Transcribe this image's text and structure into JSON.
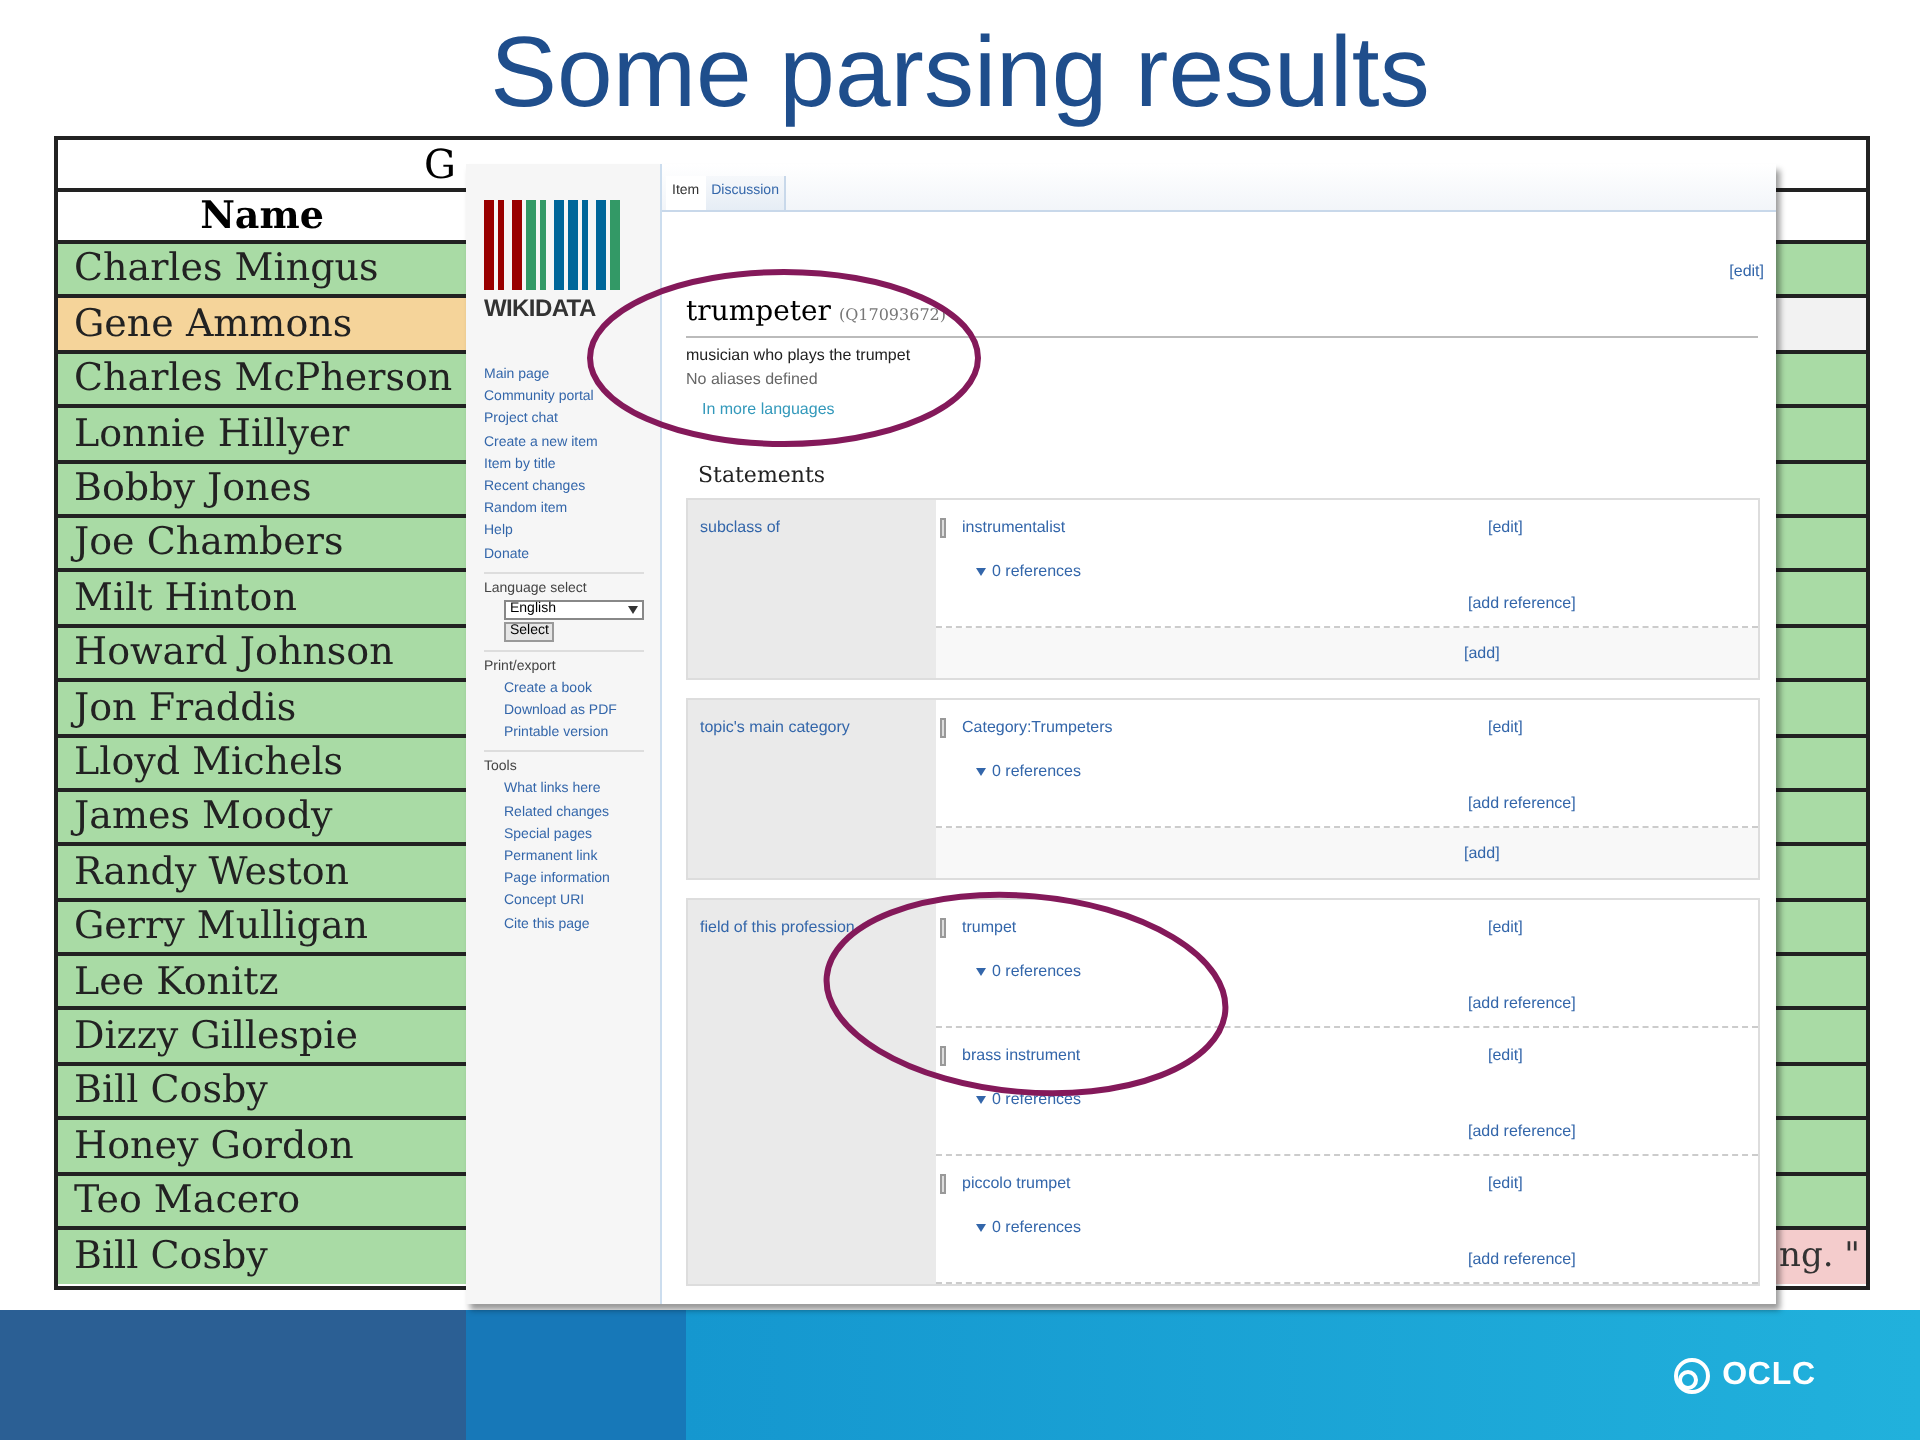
{
  "slide": {
    "title": "Some parsing results"
  },
  "table": {
    "header_top": "G",
    "name_header": "Name",
    "rows": [
      {
        "name": "Charles Mingus",
        "color": "#a9dba5",
        "extracted": {
          "color": "#a9dba5"
        }
      },
      {
        "name": "Gene Ammons",
        "color": "#f5d49a",
        "extracted": {
          "color": "#f2f2f2"
        }
      },
      {
        "name": "Charles McPherson",
        "color": "#a9dba5",
        "extracted": {
          "color": "#a9dba5"
        }
      },
      {
        "name": "Lonnie Hillyer",
        "color": "#a9dba5",
        "extracted": {
          "color": "#a9dba5"
        }
      },
      {
        "name": "Bobby Jones",
        "color": "#a9dba5",
        "extracted": {
          "color": "#a9dba5"
        }
      },
      {
        "name": "Joe Chambers",
        "color": "#a9dba5",
        "extracted": {
          "color": "#a9dba5"
        }
      },
      {
        "name": "Milt Hinton",
        "color": "#a9dba5",
        "extracted": {
          "color": "#a9dba5"
        }
      },
      {
        "name": "Howard Johnson",
        "color": "#a9dba5",
        "extracted": {
          "color": "#a9dba5"
        }
      },
      {
        "name": "Jon Fraddis",
        "color": "#a9dba5",
        "extracted": {
          "color": "#a9dba5"
        }
      },
      {
        "name": "Lloyd Michels",
        "color": "#a9dba5",
        "extracted": {
          "color": "#a9dba5"
        }
      },
      {
        "name": "James Moody",
        "color": "#a9dba5",
        "extracted": {
          "color": "#a9dba5"
        }
      },
      {
        "name": "Randy Weston",
        "color": "#a9dba5",
        "extracted": {
          "color": "#a9dba5"
        }
      },
      {
        "name": "Gerry Mulligan",
        "color": "#a9dba5",
        "extracted": {
          "color": "#a9dba5"
        }
      },
      {
        "name": "Lee Konitz",
        "color": "#a9dba5",
        "extracted": {
          "color": "#a9dba5"
        }
      },
      {
        "name": "Dizzy Gillespie",
        "color": "#a9dba5",
        "extracted": {
          "color": "#a9dba5"
        }
      },
      {
        "name": "Bill Cosby",
        "color": "#a9dba5",
        "extracted": {
          "color": "#a9dba5"
        }
      },
      {
        "name": "Honey Gordon",
        "color": "#a9dba5",
        "extracted": {
          "color": "#a9dba5"
        }
      },
      {
        "name": "Teo Macero",
        "color": "#a9dba5",
        "extracted": {
          "color": "#a9dba5"
        }
      },
      {
        "name": "Bill Cosby",
        "color": "#a9dba5",
        "extracted": {
          "color": "#f4cccc",
          "text": "ng. \""
        }
      }
    ]
  },
  "wikidata": {
    "logo_text": "WIKIDATA",
    "nav": [
      "Main page",
      "Community portal",
      "Project chat",
      "Create a new item",
      "Item by title",
      "Recent changes",
      "Random item",
      "Help",
      "Donate"
    ],
    "language": {
      "heading": "Language select",
      "value": "English",
      "button": "Select"
    },
    "sections": [
      {
        "heading": "Print/export",
        "items": [
          "Create a book",
          "Download as PDF",
          "Printable version"
        ]
      },
      {
        "heading": "Tools",
        "items": [
          "What links here",
          "Related changes",
          "Special pages",
          "Permanent link",
          "Page information",
          "Concept URI",
          "Cite this page"
        ]
      }
    ],
    "tabs": [
      {
        "label": "Item",
        "selected": true
      },
      {
        "label": "Discussion",
        "selected": false
      }
    ],
    "edit": "[edit]",
    "label": "trumpeter",
    "id": "(Q17093672)",
    "description": "musician who plays the trumpet",
    "aliases": "No aliases defined",
    "more_languages": "In more languages",
    "statements_heading": "Statements",
    "statements": [
      {
        "property": "subclass of",
        "values": [
          {
            "value": "instrumentalist",
            "references": "0 references",
            "edit": "[edit]",
            "add_reference": "[add reference]"
          }
        ],
        "add": "[add]"
      },
      {
        "property": "topic's main category",
        "values": [
          {
            "value": "Category:Trumpeters",
            "references": "0 references",
            "edit": "[edit]",
            "add_reference": "[add reference]"
          }
        ],
        "add": "[add]"
      },
      {
        "property": "field of this profession",
        "values": [
          {
            "value": "trumpet",
            "references": "0 references",
            "edit": "[edit]",
            "add_reference": "[add reference]"
          },
          {
            "value": "brass instrument",
            "references": "0 references",
            "edit": "[edit]",
            "add_reference": "[add reference]"
          },
          {
            "value": "piccolo trumpet",
            "references": "0 references",
            "edit": "[edit]",
            "add_reference": "[add reference]"
          }
        ]
      }
    ]
  },
  "footer": {
    "logo": "OCLC"
  }
}
